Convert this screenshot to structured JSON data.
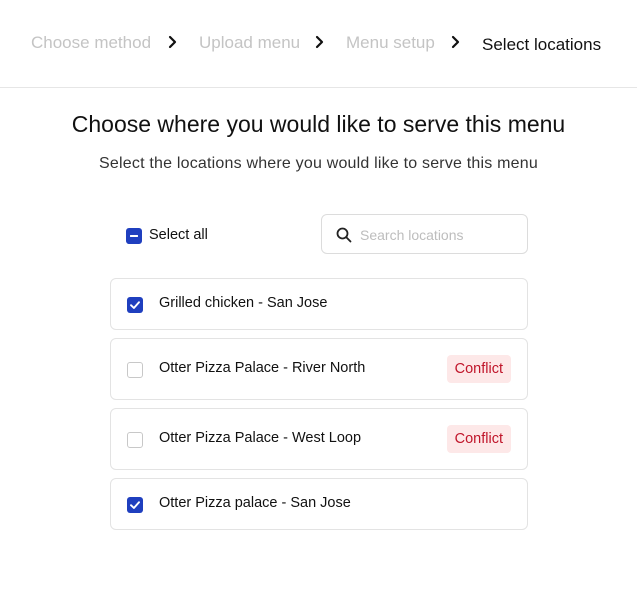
{
  "stepper": {
    "steps": [
      {
        "label": "Choose method",
        "state": "inactive"
      },
      {
        "label": "Upload menu",
        "state": "inactive"
      },
      {
        "label": "Menu setup",
        "state": "inactive"
      },
      {
        "label": "Select locations",
        "state": "active"
      }
    ],
    "separator_icon": "chevron-right-icon"
  },
  "header": {
    "title": "Choose where you would like to serve this menu",
    "subtitle": "Select the locations where you would like to serve this menu"
  },
  "controls": {
    "select_all_label": "Select all",
    "select_all_state": "indeterminate",
    "search_placeholder": "Search locations",
    "search_value": "",
    "search_icon": "search-icon"
  },
  "locations": [
    {
      "name": "Grilled chicken - San Jose",
      "checked": true,
      "badge": ""
    },
    {
      "name": "Otter Pizza Palace - River North",
      "checked": false,
      "badge": "Conflict"
    },
    {
      "name": "Otter Pizza Palace - West Loop",
      "checked": false,
      "badge": "Conflict"
    },
    {
      "name": "Otter Pizza palace - San Jose",
      "checked": true,
      "badge": ""
    }
  ],
  "colors": {
    "accent": "#1f3fbf",
    "conflict_text": "#c0152a",
    "conflict_bg": "#fde8e8",
    "inactive_step": "#c4c4c4"
  }
}
